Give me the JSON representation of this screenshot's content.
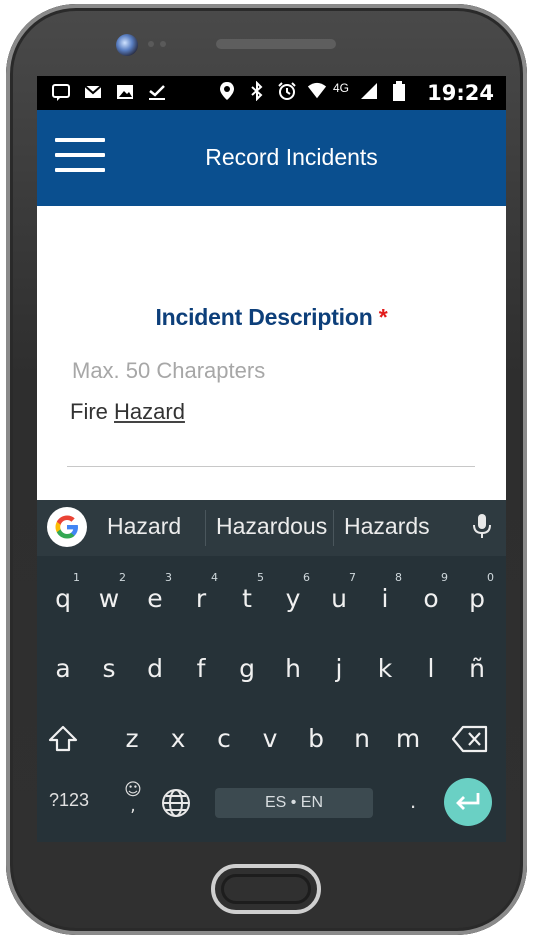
{
  "status_bar": {
    "time": "19:24",
    "network": "4G",
    "left_icons": [
      "chat-icon",
      "mail-icon",
      "image-icon",
      "checkmark-icon"
    ],
    "right_icons": [
      "location-icon",
      "bluetooth-icon",
      "alarm-icon",
      "wifi-icon",
      "signal-icon",
      "battery-icon"
    ]
  },
  "app_bar": {
    "title": "Record Incidents",
    "menu_icon": "hamburger-menu-icon",
    "color": "#0a4f8f"
  },
  "form": {
    "label": "Incident Description",
    "required_marker": "*",
    "placeholder": "Max. 50 Charapters",
    "value_prefix": "Fire",
    "value_highlight": "Hazard"
  },
  "keyboard": {
    "suggestions": [
      "Hazard",
      "Hazardous",
      "Hazards"
    ],
    "row1": [
      {
        "k": "q",
        "n": "1"
      },
      {
        "k": "w",
        "n": "2"
      },
      {
        "k": "e",
        "n": "3"
      },
      {
        "k": "r",
        "n": "4"
      },
      {
        "k": "t",
        "n": "5"
      },
      {
        "k": "y",
        "n": "6"
      },
      {
        "k": "u",
        "n": "7"
      },
      {
        "k": "i",
        "n": "8"
      },
      {
        "k": "o",
        "n": "9"
      },
      {
        "k": "p",
        "n": "0"
      }
    ],
    "row2": [
      "a",
      "s",
      "d",
      "f",
      "g",
      "h",
      "j",
      "k",
      "l",
      "ñ"
    ],
    "row3": [
      "z",
      "x",
      "c",
      "v",
      "b",
      "n",
      "m"
    ],
    "symbols_label": "?123",
    "emoji_label": "☺\n,",
    "language_label": "ES • EN",
    "period_label": ".",
    "enter_color": "#6ad0c4"
  }
}
